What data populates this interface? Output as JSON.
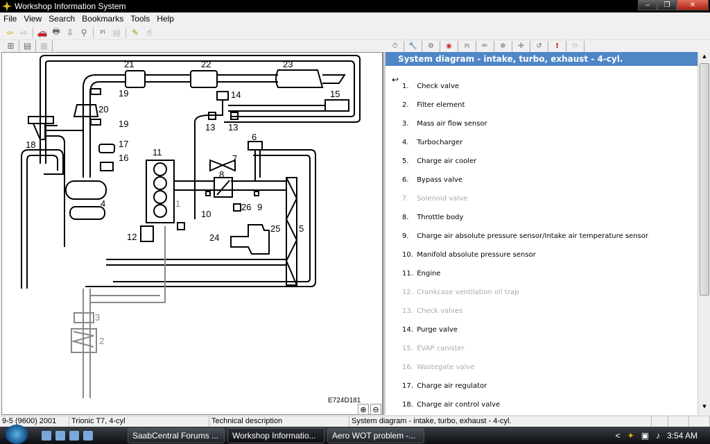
{
  "window": {
    "title": "Workshop Information System",
    "controls": {
      "minimize": "‒",
      "restore": "❐",
      "close": "✕"
    }
  },
  "menu": [
    "File",
    "View",
    "Search",
    "Bookmarks",
    "Tools",
    "Help"
  ],
  "toolbar": {
    "icons": [
      "back-arrow",
      "forward-arrow",
      "car",
      "printer",
      "download-doc",
      "binoculars",
      "pi",
      "bin",
      "pencil",
      "pointer"
    ],
    "glyphs": [
      "⇦",
      "⇨",
      "🚗",
      "🖶",
      "⇩",
      "⚲",
      "PI",
      "▤",
      "✎",
      "☝"
    ],
    "pi_label": "PI"
  },
  "left_tabs": [
    {
      "name": "tree",
      "glyph": "⊞"
    },
    {
      "name": "document",
      "glyph": "▤"
    },
    {
      "name": "graphics",
      "glyph": "▦"
    }
  ],
  "right_toolbar": [
    {
      "name": "timer",
      "glyph": "⏱"
    },
    {
      "name": "wrench",
      "glyph": "🔧"
    },
    {
      "name": "gears",
      "glyph": "⚙"
    },
    {
      "name": "dtc",
      "glyph": "◉"
    },
    {
      "name": "pi",
      "glyph": "PI"
    },
    {
      "name": "tool",
      "glyph": "✏"
    },
    {
      "name": "component",
      "glyph": "✲"
    },
    {
      "name": "move",
      "glyph": "✛"
    },
    {
      "name": "note",
      "glyph": "↺"
    },
    {
      "name": "warning",
      "glyph": "!"
    },
    {
      "name": "tf",
      "glyph": "TF"
    }
  ],
  "diagram": {
    "code": "E724D181",
    "labels": [
      "1",
      "2",
      "3",
      "4",
      "5",
      "6",
      "7",
      "8",
      "9",
      "10",
      "11",
      "12",
      "13",
      "13",
      "14",
      "15",
      "16",
      "17",
      "18",
      "19",
      "19",
      "20",
      "21",
      "22",
      "23",
      "24",
      "25",
      "26"
    ],
    "zoom_in": "⊕",
    "zoom_out": "⊖"
  },
  "content": {
    "heading": "System diagram - intake, turbo, exhaust - 4-cyl.",
    "back_icon": "↩",
    "parts": [
      {
        "n": "1.",
        "label": "Check valve",
        "dim": false
      },
      {
        "n": "2.",
        "label": "Filter element",
        "dim": false
      },
      {
        "n": "3.",
        "label": "Mass air flow sensor",
        "dim": false
      },
      {
        "n": "4.",
        "label": "Turbocharger",
        "dim": false
      },
      {
        "n": "5.",
        "label": "Charge air cooler",
        "dim": false
      },
      {
        "n": "6.",
        "label": "Bypass valve",
        "dim": false
      },
      {
        "n": "7.",
        "label": "Solenoid valve",
        "dim": true
      },
      {
        "n": "8.",
        "label": "Throttle body",
        "dim": false
      },
      {
        "n": "9.",
        "label": "Charge air absolute pressure sensor/Intake air temperature sensor",
        "dim": false
      },
      {
        "n": "10.",
        "label": "Manifold absolute pressure sensor",
        "dim": false
      },
      {
        "n": "11.",
        "label": "Engine",
        "dim": false
      },
      {
        "n": "12.",
        "label": "Crankcase ventilation oil trap",
        "dim": true
      },
      {
        "n": "13.",
        "label": "Check valves",
        "dim": true
      },
      {
        "n": "14.",
        "label": "Purge valve",
        "dim": false
      },
      {
        "n": "15.",
        "label": "EVAP canister",
        "dim": true
      },
      {
        "n": "16.",
        "label": "Wastegate valve",
        "dim": true
      },
      {
        "n": "17.",
        "label": "Charge air regulator",
        "dim": false
      },
      {
        "n": "18.",
        "label": "Charge air control valve",
        "dim": false
      }
    ]
  },
  "status": [
    "9-5 (9600) 2001",
    "Trionic T7, 4-cyl",
    "Technical description",
    "System diagram - intake, turbo, exhaust - 4-cyl.",
    "",
    "",
    ""
  ],
  "taskbar": {
    "tasks": [
      "SaabCentral Forums ...",
      "Workshop Informatio...",
      "Aero WOT problem -..."
    ],
    "clock": "3:54 AM",
    "tray_chevron": "<"
  }
}
